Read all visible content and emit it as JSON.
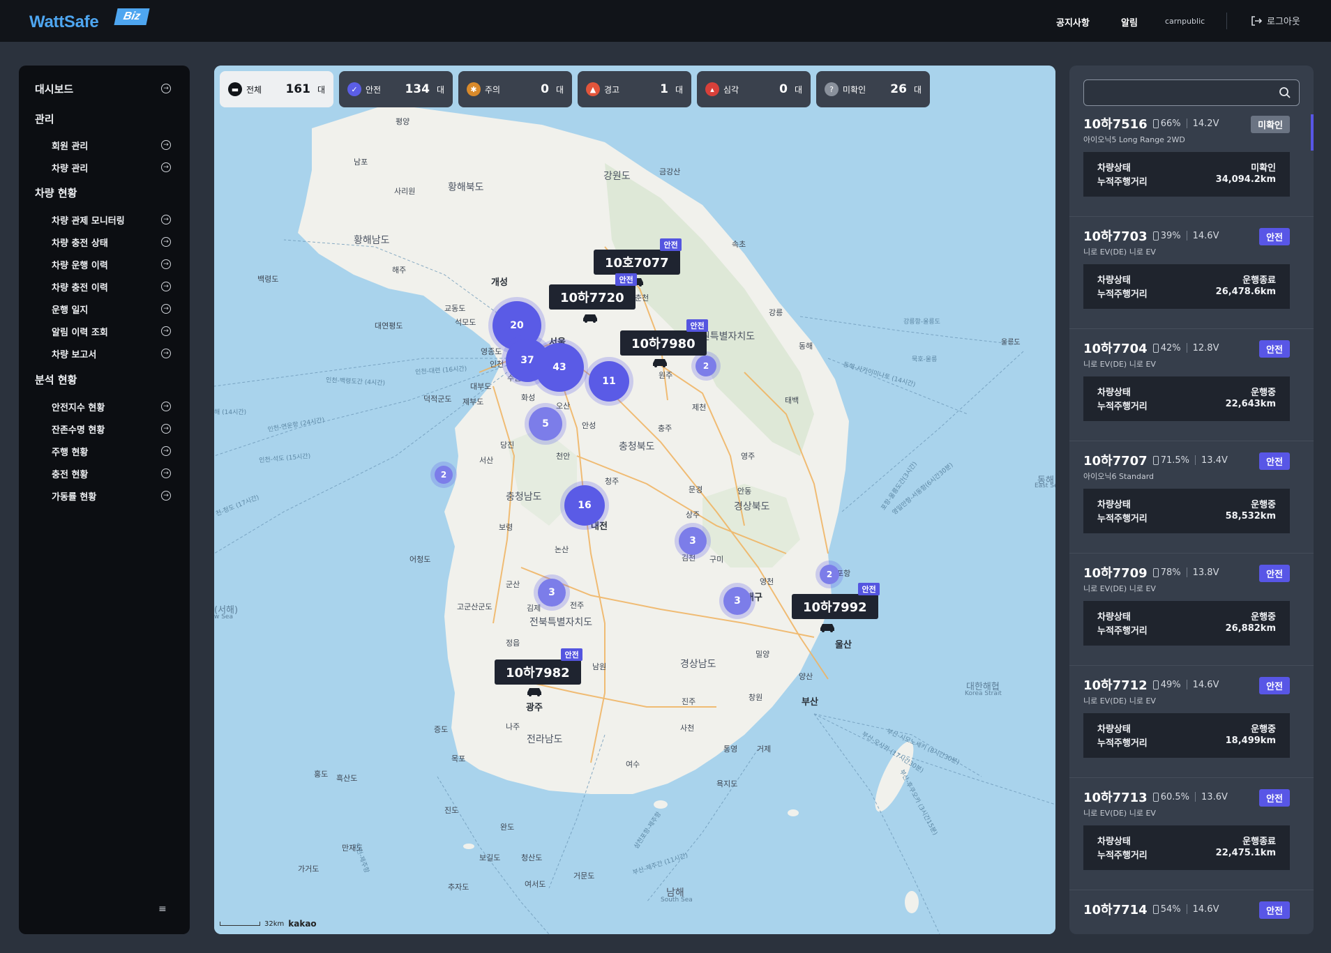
{
  "header": {
    "logo_text": "WattSafe",
    "logo_badge": "Biz",
    "notice": "공지사항",
    "alarm": "알림",
    "user": "carnpublic",
    "logout": "로그아웃"
  },
  "sidebar": {
    "dashboard": "대시보드",
    "sections": [
      {
        "title": "관리",
        "items": [
          "회원 관리",
          "차량 관리"
        ]
      },
      {
        "title": "차량 현황",
        "items": [
          "차량 관제 모니터링",
          "차량 충전 상태",
          "차량 운행 이력",
          "차량 충전 이력",
          "운행 일지",
          "알림 이력 조회",
          "차량 보고서"
        ]
      },
      {
        "title": "분석 현황",
        "items": [
          "안전지수 현황",
          "잔존수명 현황",
          "주행 현황",
          "충전 현황",
          "가동률 현황"
        ]
      }
    ]
  },
  "filters": [
    {
      "name": "전체",
      "count": "161",
      "unit": "대",
      "color": "#111418",
      "icon": "car-icon"
    },
    {
      "name": "안전",
      "count": "134",
      "unit": "대",
      "color": "#5b5ee6",
      "icon": "shield-icon"
    },
    {
      "name": "주의",
      "count": "0",
      "unit": "대",
      "color": "#d98a2b",
      "icon": "caution-icon"
    },
    {
      "name": "경고",
      "count": "1",
      "unit": "대",
      "color": "#e2553b",
      "icon": "warning-icon"
    },
    {
      "name": "심각",
      "count": "0",
      "unit": "대",
      "color": "#d8403a",
      "icon": "fire-icon"
    },
    {
      "name": "미확인",
      "count": "26",
      "unit": "대",
      "color": "#8a919c",
      "icon": "question-icon"
    }
  ],
  "map": {
    "clusters": [
      "20",
      "37",
      "43",
      "11",
      "5",
      "2",
      "16",
      "3",
      "3",
      "3",
      "2",
      "2"
    ],
    "vehicles": [
      {
        "plate": "10호7077",
        "status": "안전"
      },
      {
        "plate": "10하7720",
        "status": "안전"
      },
      {
        "plate": "10하7980",
        "status": "안전"
      },
      {
        "plate": "10하7992",
        "status": "안전"
      },
      {
        "plate": "10하7982",
        "status": "안전"
      }
    ],
    "places": [
      "평양",
      "남포",
      "사리원",
      "황해북도",
      "강원도",
      "금강산",
      "황해남도",
      "해주",
      "개성",
      "백령도",
      "속초",
      "춘천",
      "교동도",
      "석모도",
      "대연평도",
      "서울",
      "영종도",
      "인천",
      "강원특별자치도",
      "강릉",
      "동해",
      "원주",
      "2",
      "대부도",
      "수원",
      "화성",
      "오산",
      "덕적군도",
      "제부도",
      "안성",
      "제천",
      "태백",
      "충주",
      "당진",
      "천안",
      "충청북도",
      "영주",
      "서산",
      "청주",
      "문경",
      "안동",
      "충청남도",
      "경상북도",
      "보령",
      "대전",
      "상주",
      "논산",
      "김천",
      "구미",
      "어청도",
      "군산",
      "영천",
      "포항",
      "고군산군도",
      "김제",
      "전주",
      "전북특별자치도",
      "대구",
      "정읍",
      "울산",
      "남원",
      "경상남도",
      "밀양",
      "양산",
      "광주",
      "진주",
      "창원",
      "부산",
      "나주",
      "전라남도",
      "사천",
      "통영",
      "거제",
      "증도",
      "목포",
      "여수",
      "홍도",
      "흑산도",
      "진도",
      "완도",
      "욕지도",
      "만재도",
      "보길도",
      "청산도",
      "가거도",
      "추자도",
      "여서도",
      "거문도",
      "남해",
      "South Sea",
      "대한해협",
      "Korea Strait",
      "동해",
      "East Sea",
      "울릉도",
      "(서해)",
      "w Sea"
    ],
    "routes": [
      "인천-대련 (16시간)",
      "인천-백령도간 (4시간)",
      "인천-연운항 (24시간)",
      "인천-석도 (15시간)",
      "해 (14시간)",
      "천-청도 (17시간)",
      "강릉항-울릉도",
      "묵호-울릉",
      "동해-사카이미나토 (14시간)",
      "포항-울릉도간(3시간)",
      "영일만항-서동항(6시간30분)",
      "부산-시모노세키 (8시간30분)",
      "부산-오사카 (17시간30분)",
      "부산-후쿠오카 (3시간15분)",
      "삼천포항-제주항",
      "부산-제주간 (11시간)",
      "인천-제주항"
    ],
    "scale_text": "32km",
    "attribution": "kakao"
  },
  "search": {
    "placeholder": ""
  },
  "vehicles": [
    {
      "plate": "10하7516",
      "battery": "66%",
      "voltage": "14.2V",
      "badge": "미확인",
      "badge_type": "unk",
      "model": "아이오닉5 Long Range 2WD",
      "status_label": "차량상태",
      "status": "미확인",
      "dist_label": "누적주행거리",
      "distance": "34,094.2km"
    },
    {
      "plate": "10하7703",
      "battery": "39%",
      "voltage": "14.6V",
      "badge": "안전",
      "badge_type": "safe",
      "model": "니로 EV(DE) 니로 EV",
      "status_label": "차량상태",
      "status": "운행종료",
      "dist_label": "누적주행거리",
      "distance": "26,478.6km"
    },
    {
      "plate": "10하7704",
      "battery": "42%",
      "voltage": "12.8V",
      "badge": "안전",
      "badge_type": "safe",
      "model": "니로 EV(DE) 니로 EV",
      "status_label": "차량상태",
      "status": "운행중",
      "dist_label": "누적주행거리",
      "distance": "22,643km"
    },
    {
      "plate": "10하7707",
      "battery": "71.5%",
      "voltage": "13.4V",
      "badge": "안전",
      "badge_type": "safe",
      "model": "아이오닉6 Standard",
      "status_label": "차량상태",
      "status": "운행중",
      "dist_label": "누적주행거리",
      "distance": "58,532km"
    },
    {
      "plate": "10하7709",
      "battery": "78%",
      "voltage": "13.8V",
      "badge": "안전",
      "badge_type": "safe",
      "model": "니로 EV(DE) 니로 EV",
      "status_label": "차량상태",
      "status": "운행중",
      "dist_label": "누적주행거리",
      "distance": "26,882km"
    },
    {
      "plate": "10하7712",
      "battery": "49%",
      "voltage": "14.6V",
      "badge": "안전",
      "badge_type": "safe",
      "model": "니로 EV(DE) 니로 EV",
      "status_label": "차량상태",
      "status": "운행중",
      "dist_label": "누적주행거리",
      "distance": "18,499km"
    },
    {
      "plate": "10하7713",
      "battery": "60.5%",
      "voltage": "13.6V",
      "badge": "안전",
      "badge_type": "safe",
      "model": "니로 EV(DE) 니로 EV",
      "status_label": "차량상태",
      "status": "운행종료",
      "dist_label": "누적주행거리",
      "distance": "22,475.1km"
    },
    {
      "plate": "10하7714",
      "battery": "54%",
      "voltage": "14.6V",
      "badge": "안전",
      "badge_type": "safe",
      "model": "",
      "status_label": "",
      "status": "",
      "dist_label": "",
      "distance": ""
    }
  ]
}
